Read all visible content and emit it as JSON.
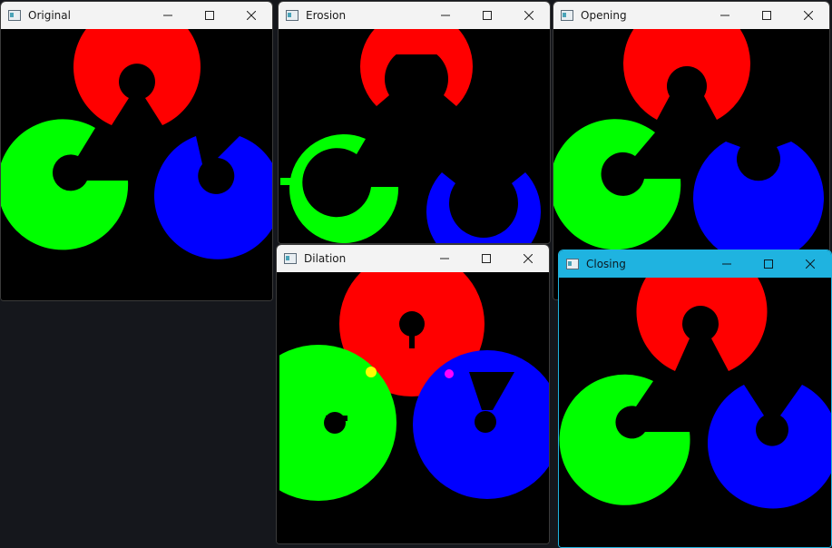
{
  "desktop": {
    "background": "#15171c"
  },
  "colors": {
    "red": "#ff0000",
    "green": "#00ff00",
    "blue": "#0000ff",
    "active_titlebar": "#1fb3e0"
  },
  "windows": [
    {
      "title": "Original",
      "active": false
    },
    {
      "title": "Erosion",
      "active": false
    },
    {
      "title": "Opening",
      "active": false
    },
    {
      "title": "Dilation",
      "active": false
    },
    {
      "title": "Closing",
      "active": true
    }
  ],
  "window_controls": {
    "minimize_icon": "minimize-icon",
    "maximize_icon": "maximize-icon",
    "close_icon": "close-icon"
  }
}
